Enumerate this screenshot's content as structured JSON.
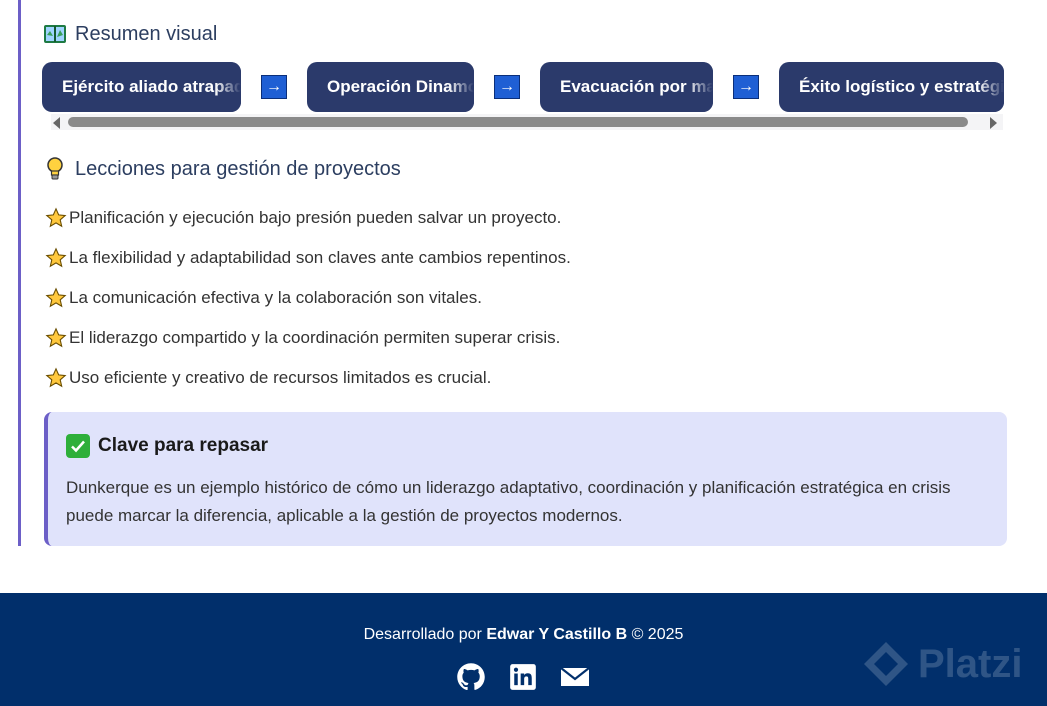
{
  "visual_summary": {
    "title": "Resumen visual",
    "icon": "map-book-icon",
    "steps": [
      "Ejército aliado atrapado",
      "Operación Dinamo",
      "Evacuación por mar",
      "Éxito logístico y estratégico"
    ],
    "arrow": "→"
  },
  "lessons": {
    "title": "Lecciones para gestión de proyectos",
    "icon": "lightbulb-icon",
    "items": [
      "Planificación y ejecución bajo presión pueden salvar un proyecto.",
      "La flexibilidad y adaptabilidad son claves ante cambios repentinos.",
      "La comunicación efectiva y la colaboración son vitales.",
      "El liderazgo compartido y la coordinación permiten superar crisis.",
      "Uso eficiente y creativo de recursos limitados es crucial."
    ]
  },
  "key": {
    "title": "Clave para repasar",
    "text": "Dunkerque es un ejemplo histórico de cómo un liderazgo adaptativo, coordinación y planificación estratégica en crisis puede marcar la diferencia, aplicable a la gestión de proyectos modernos."
  },
  "footer": {
    "prefix": "Desarrollado por ",
    "author": "Edwar Y Castillo B",
    "suffix": " © 2025",
    "links": [
      "github-icon",
      "linkedin-icon",
      "email-icon"
    ],
    "watermark": "Platzi"
  },
  "colors": {
    "accent": "#6c5fc7",
    "step_bg": "#2b3a6b",
    "arrow_bg": "#1f5fd4",
    "key_bg": "#e0e3fb",
    "footer_bg": "#012f6b"
  }
}
